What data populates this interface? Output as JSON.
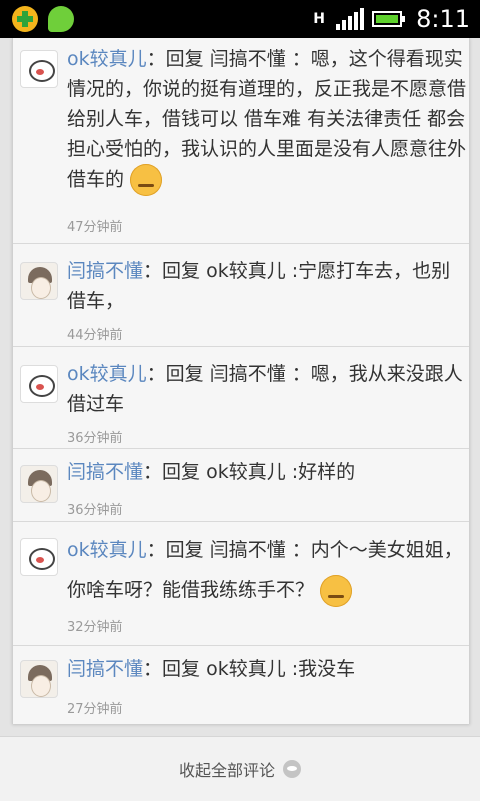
{
  "status_bar": {
    "network": "H",
    "time": "8:11",
    "battery_level": 0.8,
    "signal_level": 1.0,
    "left_icons": [
      "plus-shield-icon",
      "wechat-icon"
    ]
  },
  "comments": [
    {
      "author": "ok较真儿",
      "separator": "：",
      "text": "回复 闫搞不懂 ：嗯，这个得看现实情况的，你说的挺有道理的，反正我是不愿意借给别人车，借钱可以 借车难 有关法律责任 都会担心受怕的，我认识的人里面是没有人愿意往外借车的",
      "emoji": "worried-sweat-emoji",
      "time": "47分钟前",
      "avatar": "cat-avatar"
    },
    {
      "author": "闫搞不懂",
      "separator": "：",
      "text": "回复 ok较真儿 :宁愿打车去，也别借车，",
      "time": "44分钟前",
      "avatar": "face-avatar"
    },
    {
      "author": "ok较真儿",
      "separator": "：",
      "text": "回复 闫搞不懂 ：嗯，我从来没跟人借过车",
      "time": "36分钟前",
      "avatar": "cat-avatar"
    },
    {
      "author": "闫搞不懂",
      "separator": "：",
      "text": "回复 ok较真儿 :好样的",
      "time": "36分钟前",
      "avatar": "face-avatar"
    },
    {
      "author": "ok较真儿",
      "separator": "：",
      "text": "回复 闫搞不懂 ：内个～美女姐姐，你啥车呀？能借我练练手不？",
      "emoji": "unamused-emoji",
      "time": "32分钟前",
      "avatar": "cat-avatar"
    },
    {
      "author": "闫搞不懂",
      "separator": "：",
      "text": "回复 ok较真儿 :我没车",
      "time": "27分钟前",
      "avatar": "face-avatar"
    }
  ],
  "bottom": {
    "collapse_label": "收起全部评论",
    "collapse_icon": "cat-icon"
  }
}
